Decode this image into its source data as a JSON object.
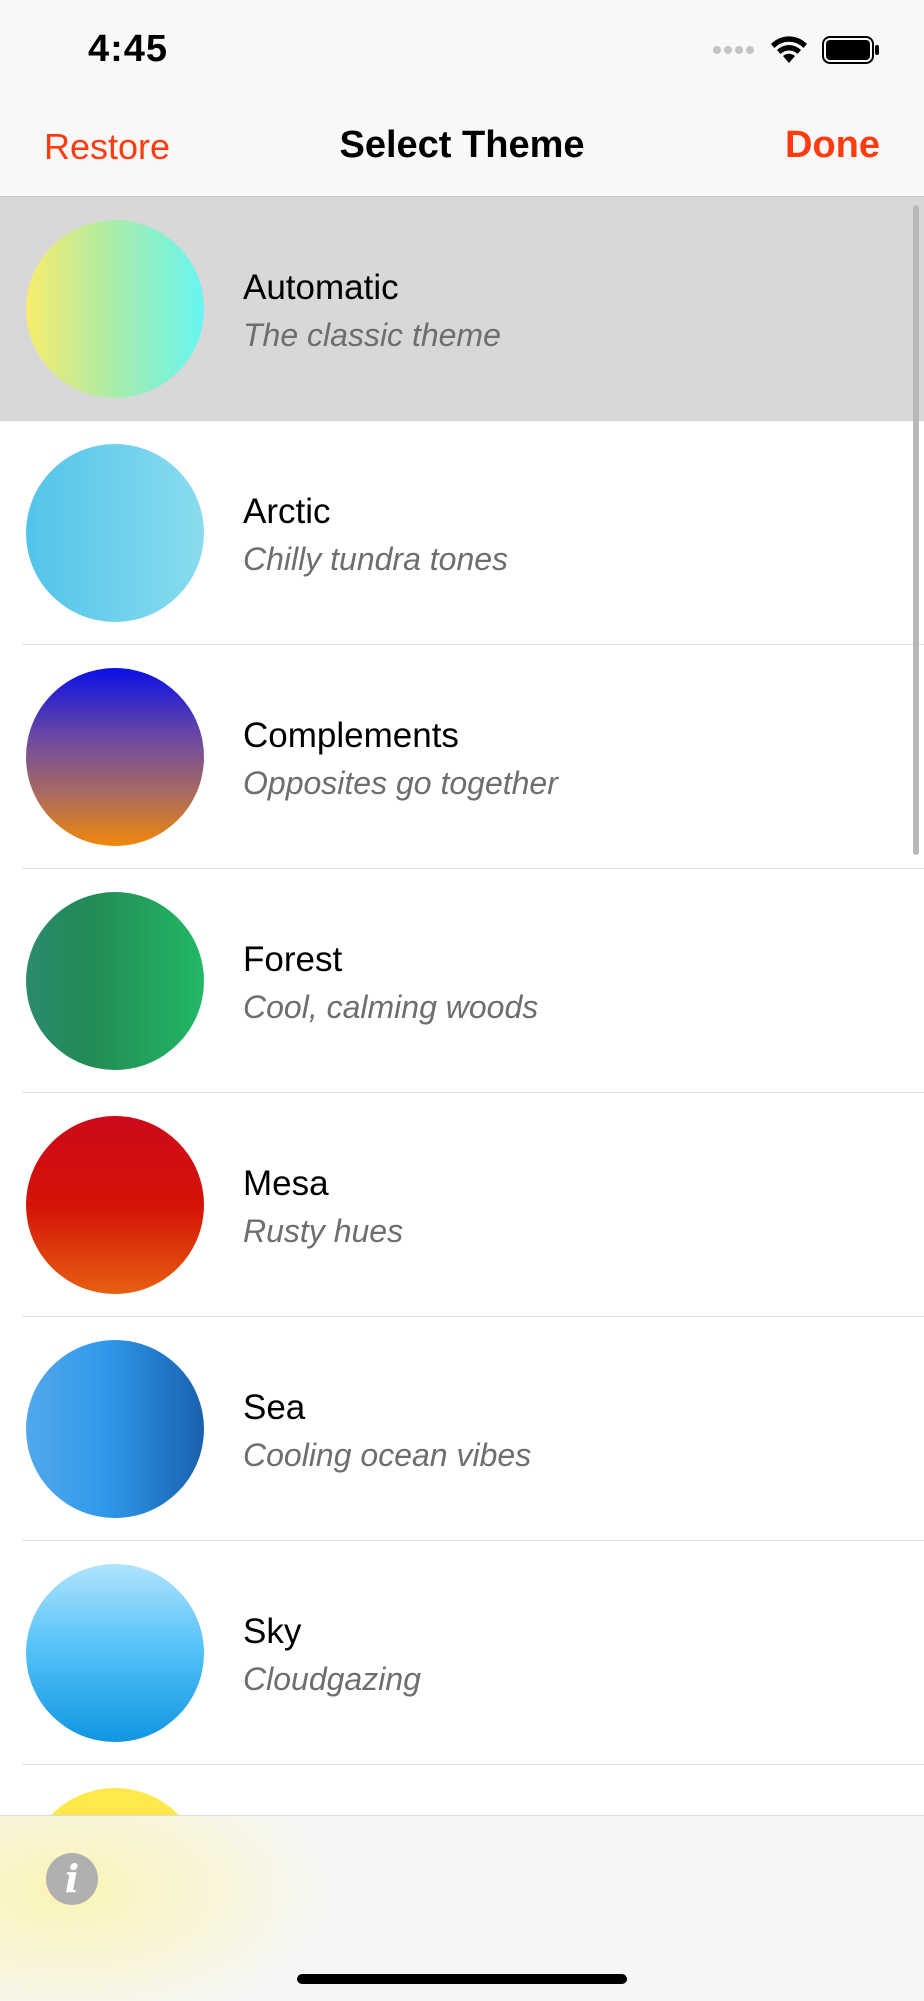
{
  "status": {
    "time": "4:45"
  },
  "nav": {
    "restore_label": "Restore",
    "title": "Select Theme",
    "done_label": "Done"
  },
  "themes": [
    {
      "name": "Automatic",
      "description": "The classic theme",
      "selected": true,
      "gradient": "linear-gradient(90deg, #f8ec6c 0%, #a8ecaa 50%, #66f6f2 100%)"
    },
    {
      "name": "Arctic",
      "description": "Chilly tundra tones",
      "selected": false,
      "gradient": "linear-gradient(90deg, #52c4ea 0%, #8adcee 100%)"
    },
    {
      "name": "Complements",
      "description": "Opposites go together",
      "selected": false,
      "gradient": "linear-gradient(180deg, #0a10e6 0%, #6e4aa0 40%, #a86a60 70%, #f0880a 100%)"
    },
    {
      "name": "Forest",
      "description": "Cool, calming woods",
      "selected": false,
      "gradient": "linear-gradient(90deg, #2b8a6e 0%, #238a55 35%, #22b866 100%)"
    },
    {
      "name": "Mesa",
      "description": "Rusty hues",
      "selected": false,
      "gradient": "linear-gradient(180deg, #cc0a1a 0%, #d41206 50%, #e66012 100%)"
    },
    {
      "name": "Sea",
      "description": "Cooling ocean vibes",
      "selected": false,
      "gradient": "linear-gradient(90deg, #52a8ec 0%, #2e98ea 45%, #1a60ae 100%)"
    },
    {
      "name": "Sky",
      "description": "Cloudgazing",
      "selected": false,
      "gradient": "linear-gradient(180deg, #b0e4fc 0%, #58c4f8 45%, #1096e2 100%)"
    },
    {
      "name": "",
      "description": "",
      "selected": false,
      "gradient": "linear-gradient(180deg, #ffe84a 0%, #ffe84a 100%)"
    }
  ],
  "colors": {
    "accent": "#ff3b10",
    "selected_row": "#d8d8d8"
  },
  "icons": {
    "info": "info-icon"
  },
  "info_glyph": "i"
}
